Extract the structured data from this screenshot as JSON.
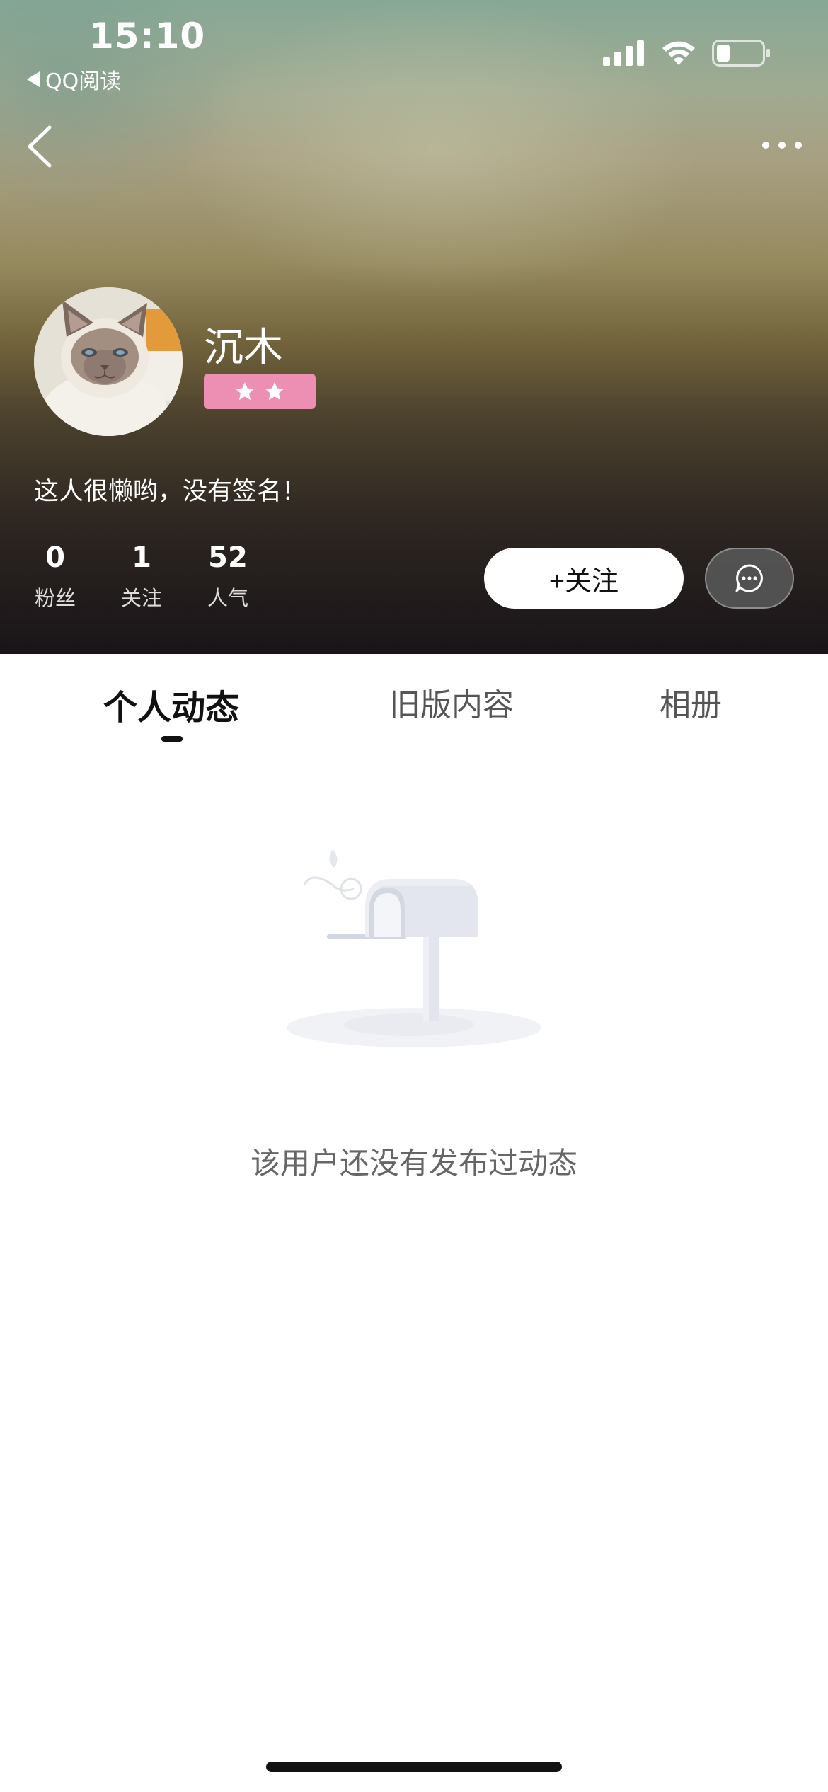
{
  "status_bar": {
    "time": "15:10",
    "back_app": "QQ阅读"
  },
  "profile": {
    "username": "沉木",
    "signature": "这人很懒哟，没有签名！",
    "level_stars": 2,
    "stats": [
      {
        "value": "0",
        "label": "粉丝"
      },
      {
        "value": "1",
        "label": "关注"
      },
      {
        "value": "52",
        "label": "人气"
      }
    ],
    "follow_button": "+关注"
  },
  "tabs": [
    {
      "label": "个人动态",
      "active": true
    },
    {
      "label": "旧版内容",
      "active": false
    },
    {
      "label": "相册",
      "active": false
    }
  ],
  "empty_state": {
    "message": "该用户还没有发布过动态"
  },
  "colors": {
    "badge": "#ec8fb2",
    "follow_button_bg": "#ffffff"
  },
  "icons": {
    "back": "chevron-left-icon",
    "more": "more-horizontal-icon",
    "message": "chat-bubble-icon",
    "signal": "signal-icon",
    "wifi": "wifi-icon",
    "battery": "battery-icon",
    "star": "star-icon",
    "empty": "mailbox-illustration"
  }
}
